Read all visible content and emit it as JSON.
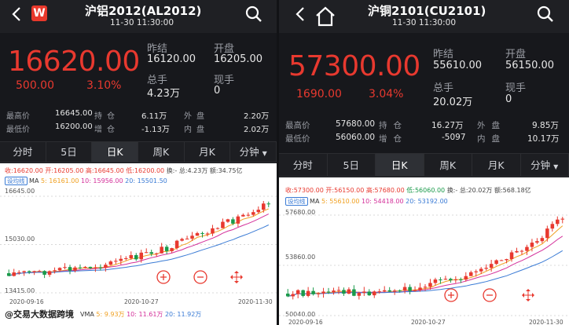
{
  "left": {
    "header": {
      "title": "沪铝2012(AL2012)",
      "time": "11-30 11:30:00",
      "logo": "W"
    },
    "price": {
      "last": "16620.00",
      "change": "500.00",
      "pct": "3.10%"
    },
    "stats": {
      "prev_settle_label": "昨结",
      "prev_settle": "16120.00",
      "open_label": "开盘",
      "open": "16205.00",
      "volume_label": "总手",
      "volume": "4.23万",
      "cur_label": "现手",
      "cur": "0"
    },
    "stats2": {
      "high_label": "最高价",
      "high": "16645.00",
      "oi_label": "持仓",
      "oi": "6.11万",
      "outer_label": "外盘",
      "outer": "2.20万",
      "low_label": "最低价",
      "low": "16200.00",
      "add_label": "增仓",
      "add": "-1.13万",
      "inner_label": "内盘",
      "inner": "2.02万"
    },
    "tabs": [
      "分时",
      "5日",
      "日K",
      "周K",
      "月K",
      "分钟"
    ],
    "legend1": {
      "shou": "收:16620.00",
      "kai": "开:16205.00",
      "gao": "高:16645.00",
      "di": "低:16200.00",
      "huan": "换:-",
      "zong": "总:4.23万",
      "e": "额:34.75亿"
    },
    "legend2": {
      "badge": "设均线",
      "ma": "MA",
      "ma5": "5: 16161.00",
      "ma10": "10: 15956.00",
      "ma20": "20: 15501.50"
    },
    "yticks": {
      "top": "16645.00",
      "mid": "15030.00",
      "bot": "13415.00"
    },
    "xticks": {
      "a": "2020-09-16",
      "b": "2020-10-27",
      "c": "2020-11-30"
    },
    "vma": {
      "label": "VMA",
      "v5": "5: 9.93万",
      "v10": "10: 11.61万",
      "v20": "20: 11.92万"
    },
    "watermark": "@交易大数据跨境"
  },
  "right": {
    "header": {
      "title": "沪铜2101(CU2101)",
      "time": "11-30 11:30:00"
    },
    "price": {
      "last": "57300.00",
      "change": "1690.00",
      "pct": "3.04%"
    },
    "stats": {
      "prev_settle_label": "昨结",
      "prev_settle": "55610.00",
      "open_label": "开盘",
      "open": "56150.00",
      "volume_label": "总手",
      "volume": "20.02万",
      "cur_label": "现手",
      "cur": "0"
    },
    "stats2": {
      "high_label": "最高价",
      "high": "57680.00",
      "oi_label": "持仓",
      "oi": "16.27万",
      "outer_label": "外盘",
      "outer": "9.85万",
      "low_label": "最低价",
      "low": "56060.00",
      "add_label": "增仓",
      "add": "-5097",
      "inner_label": "内盘",
      "inner": "10.17万"
    },
    "tabs": [
      "分时",
      "5日",
      "日K",
      "周K",
      "月K",
      "分钟"
    ],
    "legend1": {
      "shou": "收:57300.00",
      "kai": "开:56150.00",
      "gao": "高:57680.00",
      "di": "低:56060.00",
      "huan": "换:-",
      "zong": "总:20.02万",
      "e": "额:568.18亿"
    },
    "legend2": {
      "badge": "设均线",
      "ma": "MA",
      "ma5": "5: 55610.00",
      "ma10": "10: 54418.00",
      "ma20": "20: 53192.00"
    },
    "yticks": {
      "top": "57680.00",
      "mid": "53860.00",
      "bot": "50040.00"
    },
    "xticks": {
      "a": "2020-09-16",
      "b": "2020-10-27",
      "c": "2020-11-30"
    }
  },
  "colors": {
    "up": "#e8392f",
    "down": "#1a9a4a",
    "ma5": "#f0a020",
    "ma10": "#d4309a",
    "ma20": "#3a7bd5",
    "bg": "#17181c"
  }
}
